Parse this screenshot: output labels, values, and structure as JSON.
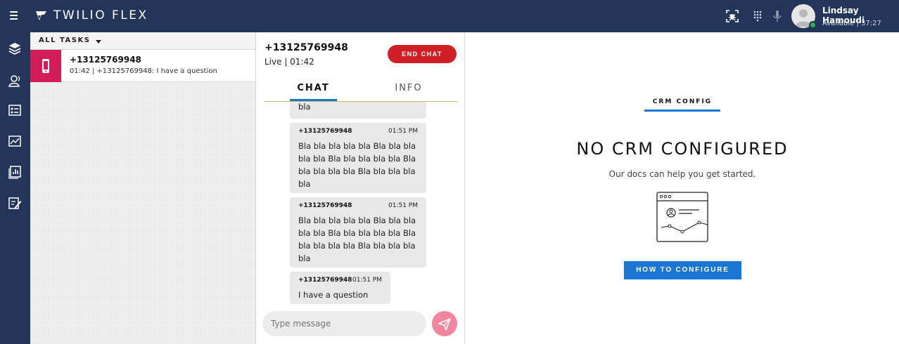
{
  "app": {
    "title": "TWILIO FLEX"
  },
  "user": {
    "name": "Lindsay Hamoudi",
    "status": "Available | 37:27"
  },
  "topbar_icons": [
    "menu-icon",
    "twilio-logo-icon",
    "debug-bug-icon",
    "dialpad-icon",
    "microphone-icon"
  ],
  "nav_icons": [
    "layers-icon",
    "agents-icon",
    "teams-icon",
    "insights-icon",
    "reports-icon",
    "wrapup-icon"
  ],
  "tasks": {
    "header": "ALL TASKS",
    "items": [
      {
        "title": "+13125769948",
        "subtitle": "01:42 | +13125769948: I have a question",
        "color": "#d21b59"
      }
    ]
  },
  "chat": {
    "number": "+13125769948",
    "status": "Live | 01:42",
    "end_chat_label": "END CHAT",
    "tabs": [
      {
        "label": "CHAT",
        "active": true
      },
      {
        "label": "INFO",
        "active": false
      }
    ],
    "messages": [
      {
        "author": "",
        "time": "",
        "lines": [
          "bla"
        ]
      },
      {
        "author": "+13125769948",
        "time": "01:51 PM",
        "lines": [
          "Bla bla bla bla bla Bla bla bla",
          "bla bla Bla bla bla bla bla Bla",
          "bla bla bla bla Bla bla bla bla",
          "bla"
        ]
      },
      {
        "author": "+13125769948",
        "time": "01:51 PM",
        "lines": [
          "Bla bla bla bla bla Bla bla bla",
          "bla bla Bla bla bla bla bla Bla",
          "bla bla bla bla Bla bla bla bla",
          "bla"
        ]
      },
      {
        "author": "+13125769948",
        "time": "01:51 PM",
        "lines": [
          "I have a question"
        ]
      }
    ],
    "input_placeholder": "Type message"
  },
  "crm": {
    "label": "CRM CONFIG",
    "title": "NO CRM CONFIGURED",
    "subtitle": "Our docs can help you get started.",
    "button": "HOW TO CONFIGURE",
    "illustration_icon": "browser-profile-chart-icon"
  },
  "colors": {
    "topbar": "#233659",
    "accent": "#1976d2",
    "end_chat": "#d11f27",
    "send": "#f2849e",
    "task_stripe": "#d21b59"
  }
}
